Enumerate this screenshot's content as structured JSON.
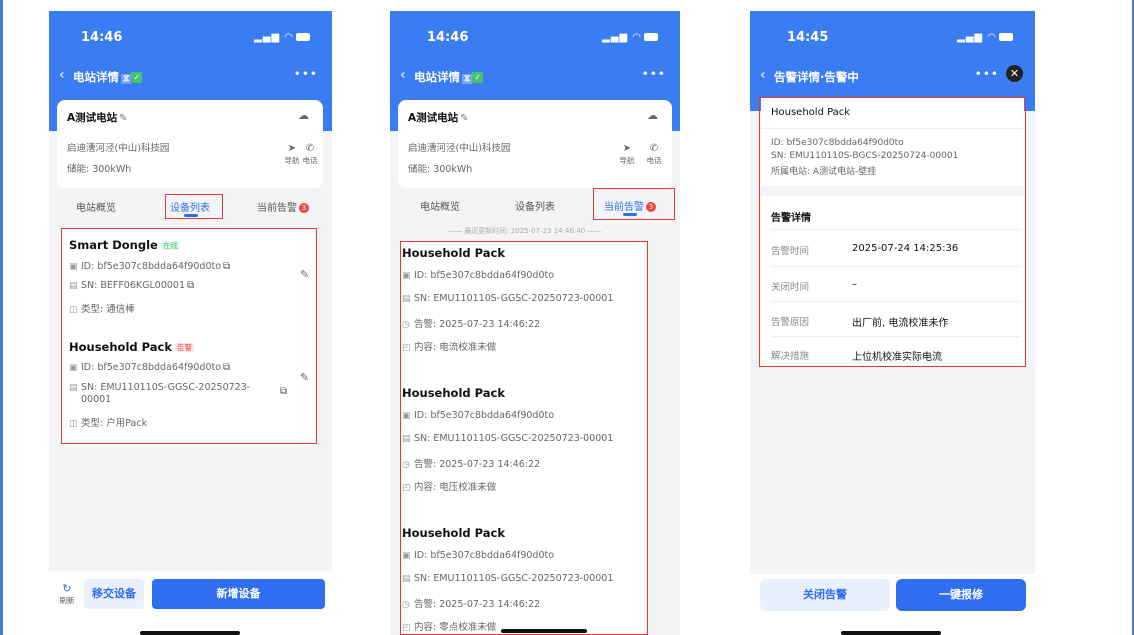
{
  "status_bar": {
    "phone1_time": "14:46",
    "phone2_time": "14:46",
    "phone3_time": "14:45"
  },
  "phone1": {
    "nav_title": "电站详情",
    "nav_tag": "⧖",
    "station_name": "A测试电站",
    "address": "启迪漕河泾(中山)科技园",
    "capacity": "储能: 300kWh",
    "action_nav": "导航",
    "action_call": "电话",
    "tabs": [
      "电站概览",
      "设备列表",
      "当前告警"
    ],
    "alarm_badge": "3",
    "devices": [
      {
        "name": "Smart Dongle",
        "status": "在线",
        "id": "ID: bf5e307c8bdda64f90d0to",
        "sn": "SN: BEFF06KGL00001",
        "type": "类型: 通信棒"
      },
      {
        "name": "Household Pack",
        "status": "告警",
        "id": "ID: bf5e307c8bdda64f90d0to",
        "sn_line1": "SN: EMU110110S-GGSC-20250723-",
        "sn_line2": "00001",
        "type": "类型: 户用Pack"
      }
    ],
    "refresh_label": "刷新",
    "transfer_button": "移交设备",
    "add_button": "新增设备"
  },
  "phone2": {
    "nav_title": "电站详情",
    "nav_tag": "⧖",
    "station_name": "A测试电站",
    "address": "启迪漕河泾(中山)科技园",
    "capacity": "储能: 300kWh",
    "action_nav": "导航",
    "action_call": "电话",
    "tabs": [
      "电站概览",
      "设备列表",
      "当前告警"
    ],
    "alarm_badge": "3",
    "updated": "最近更新时间: 2025-07-23 14:46:40",
    "alarms": [
      {
        "name": "Household Pack",
        "id": "ID: bf5e307c8bdda64f90d0to",
        "sn": "SN: EMU110110S-GGSC-20250723-00001",
        "time": "告警: 2025-07-23 14:46:22",
        "content": "内容: 电流校准未做"
      },
      {
        "name": "Household Pack",
        "id": "ID: bf5e307c8bdda64f90d0to",
        "sn": "SN: EMU110110S-GGSC-20250723-00001",
        "time": "告警: 2025-07-23 14:46:22",
        "content": "内容: 电压校准未做"
      },
      {
        "name": "Household Pack",
        "id": "ID: bf5e307c8bdda64f90d0to",
        "sn": "SN: EMU110110S-GGSC-20250723-00001",
        "time": "告警: 2025-07-23 14:46:22",
        "content": "内容: 零点校准未做"
      }
    ]
  },
  "phone3": {
    "nav_title": "告警详情·告警中",
    "device_name": "Household Pack",
    "id": "ID: bf5e307c8bdda64f90d0to",
    "sn": "SN: EMU110110S-BGCS-20250724-00001",
    "station": "所属电站: A测试电站-壁挂",
    "section_title": "告警详情",
    "rows": [
      {
        "key": "告警时间",
        "value": "2025-07-24 14:25:36"
      },
      {
        "key": "关闭时间",
        "value": "–"
      },
      {
        "key": "告警原因",
        "value": "出厂前, 电流校准未作"
      },
      {
        "key": "解决措施",
        "value": "上位机校准实际电流"
      }
    ],
    "close_button": "关闭告警",
    "repair_button": "一键报修"
  },
  "icons": {
    "back": "chevron-left-icon",
    "more": "more-icon",
    "close": "close-circle-icon",
    "cloud": "cloud-icon",
    "nav": "navigation-icon",
    "call": "phone-icon",
    "copy": "copy-icon",
    "edit": "edit-icon",
    "refresh": "refresh-icon",
    "clock": "clock-icon"
  },
  "colors": {
    "primary": "#2f6ef0",
    "header": "#3a7df3",
    "alarm": "#f0483e",
    "online": "#46c26e",
    "highlight": "#e53935"
  }
}
